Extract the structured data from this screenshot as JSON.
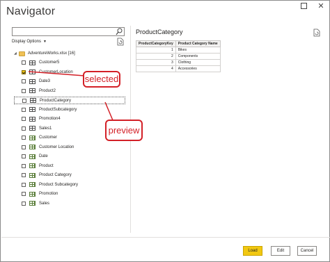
{
  "window": {
    "title": "Navigator",
    "max_glyph": "□",
    "close_glyph": "✕"
  },
  "search": {
    "value": "",
    "placeholder": ""
  },
  "display_options": {
    "label": "Display Options",
    "caret": "▼"
  },
  "tree": {
    "root": {
      "label": "AdventureWorks.xlsx [16]",
      "expanded_glyph": "◢"
    },
    "items": [
      {
        "label": "Customer5",
        "checked": false,
        "kind": "table"
      },
      {
        "label": "CustomerLocation",
        "checked": true,
        "kind": "table"
      },
      {
        "label": "Date3",
        "checked": false,
        "kind": "table"
      },
      {
        "label": "Product2",
        "checked": false,
        "kind": "table"
      },
      {
        "label": "ProductCategory",
        "checked": false,
        "kind": "table",
        "selected": true
      },
      {
        "label": "ProductSubcategory",
        "checked": false,
        "kind": "table"
      },
      {
        "label": "Promotion4",
        "checked": false,
        "kind": "table"
      },
      {
        "label": "Sales1",
        "checked": false,
        "kind": "table"
      },
      {
        "label": "Customer",
        "checked": false,
        "kind": "sheet"
      },
      {
        "label": "Customer Location",
        "checked": false,
        "kind": "sheet"
      },
      {
        "label": "Date",
        "checked": false,
        "kind": "sheet"
      },
      {
        "label": "Product",
        "checked": false,
        "kind": "sheet"
      },
      {
        "label": "Product Category",
        "checked": false,
        "kind": "sheet"
      },
      {
        "label": "Product Subcategory",
        "checked": false,
        "kind": "sheet"
      },
      {
        "label": "Promotion",
        "checked": false,
        "kind": "sheet"
      },
      {
        "label": "Sales",
        "checked": false,
        "kind": "sheet"
      }
    ]
  },
  "preview": {
    "title": "ProductCategory",
    "columns": [
      "ProductCategoryKey",
      "Product Category Name"
    ],
    "rows": [
      [
        "1",
        "Bikes"
      ],
      [
        "2",
        "Components"
      ],
      [
        "3",
        "Clothing"
      ],
      [
        "4",
        "Accessories"
      ]
    ]
  },
  "footer": {
    "load": "Load",
    "edit": "Edit",
    "cancel": "Cancel"
  },
  "annotations": {
    "selected": "selected",
    "preview": "preview"
  },
  "colors": {
    "accent": "#f2c811",
    "callout": "#d32027"
  }
}
